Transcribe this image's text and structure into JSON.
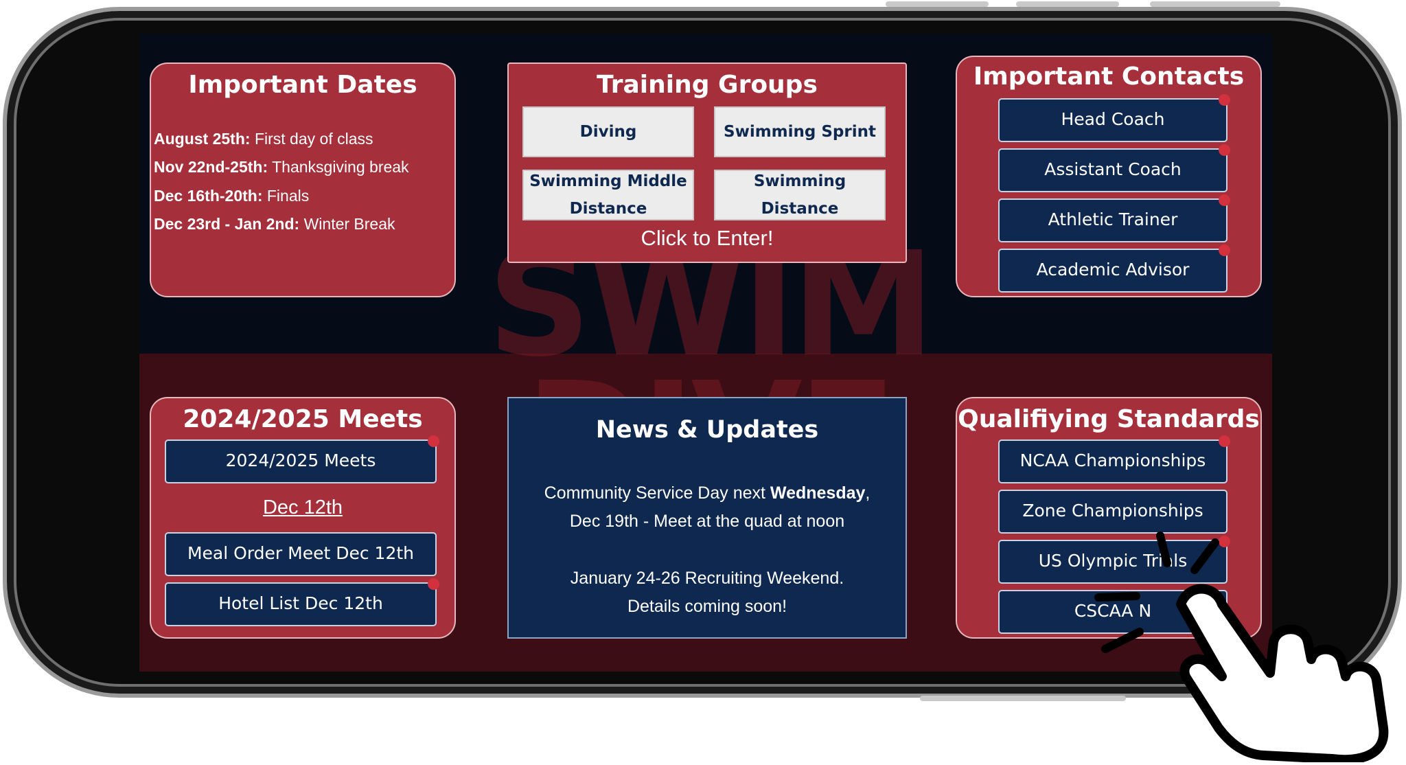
{
  "important_dates": {
    "title": "Important Dates",
    "items": [
      {
        "date": "August 25th:",
        "text": " First day of class"
      },
      {
        "date": "Nov 22nd-25th:",
        "text": " Thanksgiving break"
      },
      {
        "date": "Dec 16th-20th:",
        "text": " Finals"
      },
      {
        "date": "Dec 23rd - Jan 2nd:",
        "text": " Winter Break"
      }
    ]
  },
  "training_groups": {
    "title": "Training Groups",
    "buttons": [
      "Diving",
      "Swimming Sprint",
      "Swimming Middle Distance",
      "Swimming Distance"
    ],
    "cta": "Click to Enter!"
  },
  "important_contacts": {
    "title": "Important Contacts",
    "buttons": [
      "Head Coach",
      "Assistant Coach",
      "Athletic Trainer",
      "Academic Advisor"
    ]
  },
  "meets": {
    "title": "2024/2025 Meets",
    "button": "2024/2025 Meets",
    "link": "Dec 12th",
    "buttons": [
      "Meal Order Meet Dec 12th",
      "Hotel List Dec 12th"
    ]
  },
  "news": {
    "title": "News & Updates",
    "line1_pre": "Community Service Day next ",
    "line1_bold": "Wednesday",
    "line1_post": ",",
    "line2": "Dec 19th - Meet at the quad at noon",
    "line3": "January 24-26 Recruiting Weekend.",
    "line4": "Details coming soon!"
  },
  "qualifying": {
    "title": "Qualifiying Standards",
    "buttons": [
      "NCAA Championships",
      "Zone Championships",
      "US Olympic Trials",
      "CSCAA N"
    ]
  },
  "background_logo": "SWIM DIVE",
  "colors": {
    "card_red": "#a5303b",
    "navy": "#0e2850",
    "accent_dot": "#d3313d"
  },
  "icons": {
    "pointer": "hand-pointer-icon"
  }
}
